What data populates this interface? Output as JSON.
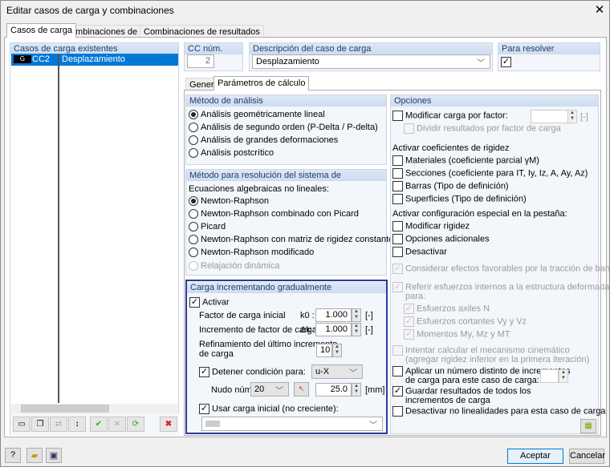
{
  "window": {
    "title": "Editar casos de carga y combinaciones",
    "close": "✕"
  },
  "tabs": [
    "Casos de carga",
    "Combinaciones de carga",
    "Combinaciones de resultados"
  ],
  "existing": {
    "header": "Casos de carga existentes",
    "rows": [
      {
        "badge": "G",
        "id": "CC2",
        "name": "Desplazamiento"
      }
    ]
  },
  "cc_num": {
    "label": "CC núm.",
    "value": "2"
  },
  "description": {
    "label": "Descripción del caso de carga",
    "value": "Desplazamiento"
  },
  "to_solve": {
    "label": "Para resolver",
    "checked": true
  },
  "subtabs": [
    "General",
    "Parámetros de cálculo"
  ],
  "analysis": {
    "header": "Método de análisis",
    "options": [
      "Análisis geométricamente lineal",
      "Análisis de segundo orden (P-Delta / P-delta)",
      "Análisis de grandes deformaciones",
      "Análisis postcrítico"
    ]
  },
  "solver": {
    "header": "Método para resolución del sistema de",
    "label": "Ecuaciones algebraicas no lineales:",
    "options": [
      "Newton-Raphson",
      "Newton-Raphson combinado con Picard",
      "Picard",
      "Newton-Raphson con matriz de rigidez constante",
      "Newton-Raphson modificado",
      "Relajación dinámica"
    ]
  },
  "incremental": {
    "header": "Carga incrementando gradualmente",
    "activate": "Activar",
    "initial_factor": {
      "label": "Factor de carga inicial",
      "symbol": "k0 :",
      "value": "1.000",
      "unit": "[-]"
    },
    "increment": {
      "label": "Incremento de factor de carga",
      "symbol": "Δk :",
      "value": "1.000",
      "unit": "[-]"
    },
    "refinement": {
      "label1": "Refinamiento del último incremento",
      "label2": "de carga",
      "value": "10"
    },
    "stop": {
      "label": "Detener condición para:",
      "value": "u-X"
    },
    "node": {
      "label": "Nudo núm.:",
      "value": "20",
      "limit": "25.0",
      "unit": "[mm]"
    },
    "initial_load": {
      "label": "Usar carga inicial (no creciente):"
    }
  },
  "options": {
    "header": "Opciones",
    "modify": "Modificar carga por factor:",
    "modify_unit": "[-]",
    "divide": "Dividir resultados por factor de carga",
    "stiff_header": "Activar coeficientes de rigidez",
    "stiff": [
      "Materiales (coeficiente parcial γM)",
      "Secciones (coeficiente para IT, Iy, Iz, A, Ay, Az)",
      "Barras (Tipo de definición)",
      "Superficies (Tipo de definición)"
    ],
    "special_header": "Activar configuración especial en la pestaña:",
    "special": [
      "Modificar rigidez",
      "Opciones adicionales",
      "Desactivar"
    ],
    "favorable": "Considerar efectos favorables por la tracción de barras",
    "refer1": "Referir esfuerzos internos a la estructura deformada",
    "refer2": "para:",
    "refer_sub": [
      "Esfuerzos axiles N",
      "Esfuerzos cortantes Vy y Vz",
      "Momentos My, Mz y MT"
    ],
    "kin1": "Intentar calcular el mecanismo cinemático",
    "kin2": "(agregar rigidez inferior en la primera iteración)",
    "apply1": "Aplicar un número distinto de incrementos",
    "apply2": "de carga para este caso de carga:",
    "save1": "Guardar resultados de todos los",
    "save2": "incrementos de carga",
    "deact": "Desactivar no linealidades para esta caso de carga"
  },
  "buttons": {
    "ok": "Aceptar",
    "cancel": "Cancelar"
  }
}
